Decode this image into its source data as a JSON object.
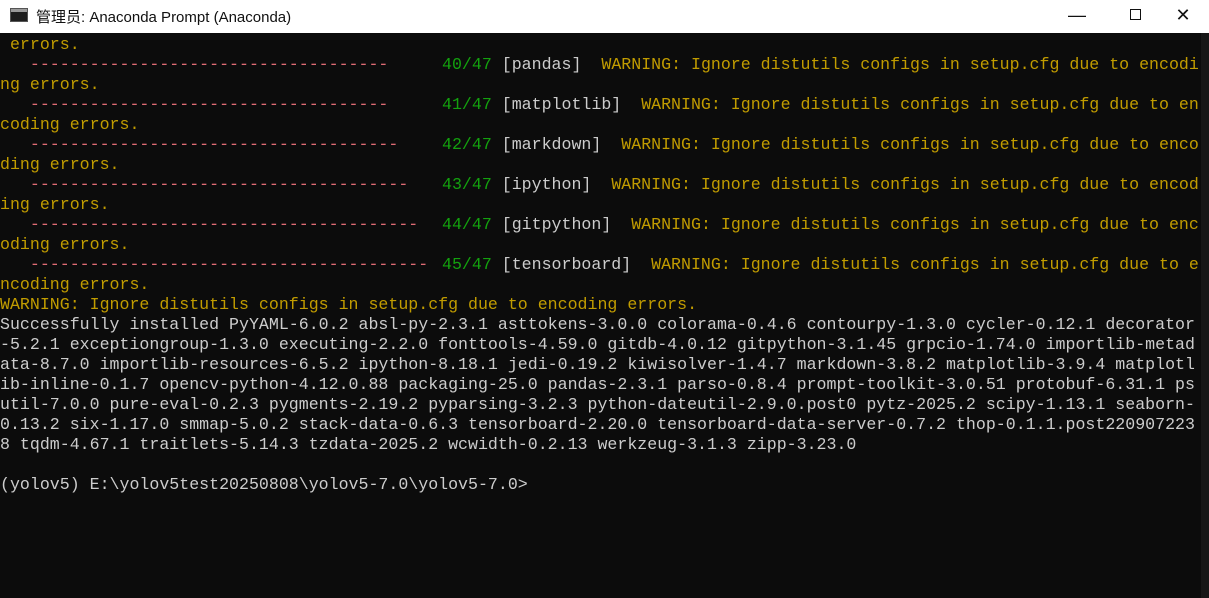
{
  "window": {
    "title": "管理员: Anaconda Prompt (Anaconda)",
    "minimize_glyph": "—",
    "close_glyph": "✕"
  },
  "console": {
    "left_lines": [
      " errors.",
      "   ------------------------------------",
      "ng errors.",
      "   ------------------------------------",
      "coding errors.",
      "   -------------------------------------",
      "ding errors.",
      "   --------------------------------------",
      "ing errors.",
      "   ---------------------------------------",
      "oding errors.",
      "   ----------------------------------------",
      "ncoding errors."
    ],
    "progress": [
      {
        "count": "40/47",
        "pkg": "[pandas]",
        "msg": "WARNING: Ignore distutils configs in setup.cfg due to encodi"
      },
      {
        "count": "41/47",
        "pkg": "[matplotlib]",
        "msg": "WARNING: Ignore distutils configs in setup.cfg due to en"
      },
      {
        "count": "42/47",
        "pkg": "[markdown]",
        "msg": "WARNING: Ignore distutils configs in setup.cfg due to enco"
      },
      {
        "count": "43/47",
        "pkg": "[ipython]",
        "msg": "WARNING: Ignore distutils configs in setup.cfg due to encod"
      },
      {
        "count": "44/47",
        "pkg": "[gitpython]",
        "msg": "WARNING: Ignore distutils configs in setup.cfg due to enc"
      },
      {
        "count": "45/47",
        "pkg": "[tensorboard]",
        "msg": "WARNING: Ignore distutils configs in setup.cfg due to e"
      }
    ],
    "warning_line": "WARNING: Ignore distutils configs in setup.cfg due to encoding errors.",
    "success_lines": [
      "Successfully installed PyYAML-6.0.2 absl-py-2.3.1 asttokens-3.0.0 colorama-0.4.6 contourpy-1.3.0 cycler-0.12.1 decorator",
      "-5.2.1 exceptiongroup-1.3.0 executing-2.2.0 fonttools-4.59.0 gitdb-4.0.12 gitpython-3.1.45 grpcio-1.74.0 importlib-metad",
      "ata-8.7.0 importlib-resources-6.5.2 ipython-8.18.1 jedi-0.19.2 kiwisolver-1.4.7 markdown-3.8.2 matplotlib-3.9.4 matplotl",
      "ib-inline-0.1.7 opencv-python-4.12.0.88 packaging-25.0 pandas-2.3.1 parso-0.8.4 prompt-toolkit-3.0.51 protobuf-6.31.1 ps",
      "util-7.0.0 pure-eval-0.2.3 pygments-2.19.2 pyparsing-3.2.3 python-dateutil-2.9.0.post0 pytz-2025.2 scipy-1.13.1 seaborn-",
      "0.13.2 six-1.17.0 smmap-5.0.2 stack-data-0.6.3 tensorboard-2.20.0 tensorboard-data-server-0.7.2 thop-0.1.1.post220907223",
      "8 tqdm-4.67.1 traitlets-5.14.3 tzdata-2025.2 wcwidth-0.2.13 werkzeug-3.1.3 zipp-3.23.0"
    ],
    "prompt": "(yolov5) E:\\yolov5test20250808\\yolov5-7.0\\yolov5-7.0>"
  }
}
